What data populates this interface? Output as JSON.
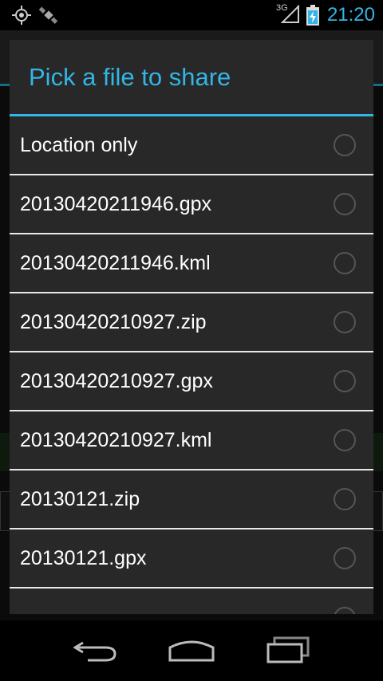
{
  "status_bar": {
    "network_type": "3G",
    "time": "21:20",
    "colors": {
      "accent": "#33b5e5"
    }
  },
  "dialog": {
    "title": "Pick a file to share",
    "items": [
      {
        "label": "Location only",
        "selected": false
      },
      {
        "label": "20130420211946.gpx",
        "selected": false
      },
      {
        "label": "20130420211946.kml",
        "selected": false
      },
      {
        "label": "20130420210927.zip",
        "selected": false
      },
      {
        "label": "20130420210927.gpx",
        "selected": false
      },
      {
        "label": "20130420210927.kml",
        "selected": false
      },
      {
        "label": "20130121.zip",
        "selected": false
      },
      {
        "label": "20130121.gpx",
        "selected": false
      }
    ]
  },
  "navigation": {
    "icons": [
      "back-icon",
      "home-icon",
      "recent-apps-icon"
    ]
  }
}
